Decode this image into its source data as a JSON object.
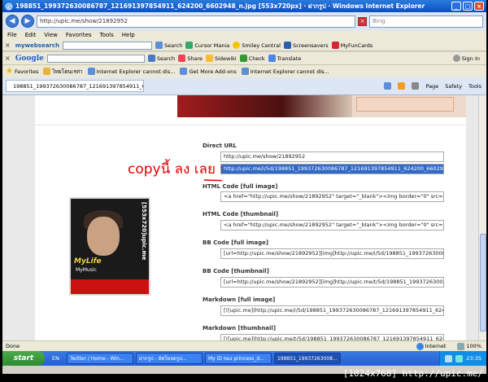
{
  "window": {
    "title": "198851_199372630086787_121691397854911_624200_6602948_n.jpg [553x720px] · ฝากรูป · Windows Internet Explorer"
  },
  "address": {
    "url": "http://upic.me/show/21892952",
    "search_placeholder": "Bing"
  },
  "menu": [
    "File",
    "Edit",
    "View",
    "Favorites",
    "Tools",
    "Help"
  ],
  "toolbar1": {
    "brand": "mywebsearch",
    "search": "Search",
    "items": [
      "Cursor Mania",
      "Smiley Central",
      "Screensavers",
      "MyFunCards"
    ]
  },
  "toolbar2": {
    "brand": "Google",
    "search": "Search",
    "items": [
      "Share",
      "Sidewiki",
      "Check",
      "Translate"
    ],
    "signin": "Sign In"
  },
  "favorites": {
    "label": "Favorites",
    "items": [
      "ไทยโดนเรท่า",
      "Internet Explorer cannot dis...",
      "Get More Add-ons",
      "Internet Explorer cannot dis..."
    ]
  },
  "tab": {
    "label": "198851_199372630086787_121691397854911_6242...",
    "cmds": [
      "Page",
      "Safety",
      "Tools"
    ]
  },
  "codes": [
    {
      "label": "Direct URL",
      "fields": [
        "http://upic.me/show/21892952",
        "http://upic.me/i/5d/198851_199372630086787_121691397854911_624200_660294"
      ]
    },
    {
      "label": "HTML Code [full image]",
      "fields": [
        "<a href=\"http://upic.me/show/21892952\" target=\"_blank\"><img border=\"0\" src=\"h"
      ]
    },
    {
      "label": "HTML Code [thumbnail]",
      "fields": [
        "<a href=\"http://upic.me/show/21892952\" target=\"_blank\"><img border=\"0\" src=\"h"
      ]
    },
    {
      "label": "BB Code [full image]",
      "fields": [
        "[url=http://upic.me/show/21892952][img]http://upic.me/i/5d/198851_19937263008"
      ]
    },
    {
      "label": "BB Code [thumbnail]",
      "fields": [
        "[url=http://upic.me/show/21892952][img]http://upic.me/t/5d/198851_19937263008"
      ]
    },
    {
      "label": "Markdown [full image]",
      "fields": [
        "[![upic.me](http://upic.me/i/5d/198851_199372630086787_121691397854911_6242"
      ]
    },
    {
      "label": "Markdown [thumbnail]",
      "fields": [
        "[![upic.me](http://upic.me/t/5d/198851_199372630086787_121691397854911_6242"
      ]
    }
  ],
  "thumbnail": {
    "side_text": "[553x720]upic.me",
    "title": "MyLife",
    "subtitle": "MyMusic"
  },
  "handwriting": "copyนี้ ลง เลย จ้ะ",
  "status": {
    "left": "Done",
    "zone": "Internet",
    "zoom": "100%"
  },
  "taskbar": {
    "start": "start",
    "lang": "EN",
    "tasks": [
      "Twitter / Home - Win...",
      "ฝากรูป - อัพโหลดรูป...",
      "My iD ของ princess_d...",
      "198851_19937263008..."
    ],
    "clock": "23:35"
  },
  "watermark": "[1024x768] http://upic.me/"
}
